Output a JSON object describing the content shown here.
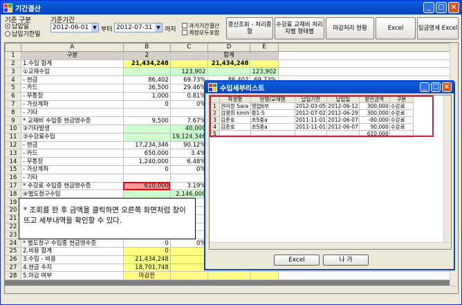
{
  "window": {
    "title": "기간결산",
    "min": "_",
    "max": "□",
    "close": "×"
  },
  "toolbar": {
    "group1_label": "기준 구분",
    "radio1": "납입일",
    "radio2": "납입기한일",
    "group2_label": "기준기간",
    "date_from": "2012-06-01",
    "sep": "부터",
    "date_to": "2012-07-31",
    "until": "까지",
    "chk1": "과거기간결산",
    "chk2": "계정모두포함",
    "btn1": "결산조회 - 처리종합",
    "btn2": "수강료 교재비 처리자별 형태별",
    "btn3": "마감처리 현황",
    "btn4": "Excel",
    "btn5": "입금명세 Excel"
  },
  "sheet": {
    "cols": [
      "A",
      "B",
      "C",
      "D",
      "E"
    ],
    "rows": [
      [
        "1",
        "구분",
        "2",
        "",
        "합계",
        ""
      ],
      [
        "2",
        "1.수입 합계",
        "21,434,248",
        "",
        "21,434,248",
        ""
      ],
      [
        "3",
        "①교재수입",
        "",
        "123,902",
        "",
        "123,902"
      ],
      [
        "4",
        "- 현금",
        "86,402",
        "69.73%",
        "86,402",
        "69.73%"
      ],
      [
        "5",
        "- 카드",
        "36,500",
        "29.46%",
        "36,500",
        "29.46%"
      ],
      [
        "6",
        "- 무통장",
        "1,000",
        "0.81%",
        "",
        ""
      ],
      [
        "7",
        "- 가상계좌",
        "0",
        "0%",
        "",
        ""
      ],
      [
        "8",
        "- 기타",
        "",
        "",
        "",
        ""
      ],
      [
        "9",
        "* 교재비 수입중 현금영수증",
        "9,500",
        "7.67%",
        "",
        ""
      ],
      [
        "10",
        "②기타발생",
        "",
        "40,000",
        "",
        ""
      ],
      [
        "11",
        "③수강료수입",
        "",
        "19,124,346",
        "",
        ""
      ],
      [
        "12",
        "- 현금",
        "17,234,346",
        "90.12%",
        "",
        ""
      ],
      [
        "13",
        "- 카드",
        "650,000",
        "3.4%",
        "",
        ""
      ],
      [
        "14",
        "- 무통장",
        "1,240,000",
        "6.48%",
        "",
        ""
      ],
      [
        "15",
        "- 가상계좌",
        "0",
        "0%",
        "",
        ""
      ],
      [
        "16",
        "- 기타",
        "",
        "",
        "",
        ""
      ],
      [
        "17",
        "* 수강료 수입중 현금영수증",
        "610,000",
        "3.19%",
        "",
        ""
      ],
      [
        "18",
        "④별도청구수입",
        "",
        "2,146,000",
        "",
        ""
      ],
      [
        "19",
        "",
        "",
        "",
        "",
        ""
      ],
      [
        "20",
        "",
        "",
        "",
        "",
        ""
      ],
      [
        "21",
        "",
        "",
        "",
        "",
        ""
      ],
      [
        "22",
        "",
        "",
        "",
        "",
        ""
      ],
      [
        "23",
        "",
        "",
        "",
        "",
        ""
      ],
      [
        "24",
        "* 별도청구 수입중 현금영수증",
        "0",
        "0%",
        "",
        ""
      ],
      [
        "25",
        "2.비용 합계",
        "0",
        "",
        "",
        ""
      ],
      [
        "26",
        "3.수입 - 비용",
        "21,434,248",
        "",
        "",
        ""
      ],
      [
        "27",
        "4.현금 수지",
        "18,701,748",
        "",
        "18,701,748",
        ""
      ],
      [
        "28",
        "5.마감 여부",
        "마감전",
        "",
        "",
        ""
      ]
    ]
  },
  "note": "* 조회를 한 후 금액을 클릭하면 오른쪽 화면처럼 창이 뜨고 세부내역을 확인할 수 있다.",
  "popup": {
    "title": "수입세부리스트",
    "headers": [
      "",
      "학생명",
      "반명/교재명",
      "납입기한",
      "납입일",
      "받은금액",
      "구분"
    ],
    "rows": [
      [
        "1",
        "권미정 Sara",
        "영업6부",
        "2012-03-05",
        "2012-06-12",
        "300,000",
        "수강료"
      ],
      [
        "2",
        "김영희 kimh",
        "중1-S",
        "2012-07-02",
        "2012-06-29",
        "300,000",
        "수강료"
      ],
      [
        "3",
        "김준호",
        "초5중a",
        "2011-11-01",
        "2012-06-07",
        "-80,000",
        "수강료"
      ],
      [
        "4",
        "김준호",
        "초5중a",
        "2011-11-01",
        "2012-06-07",
        "90,000",
        "수강료"
      ],
      [
        "5",
        "",
        "",
        "",
        "",
        "610,000",
        ""
      ]
    ],
    "excel": "Excel",
    "close_btn": "나  가"
  }
}
